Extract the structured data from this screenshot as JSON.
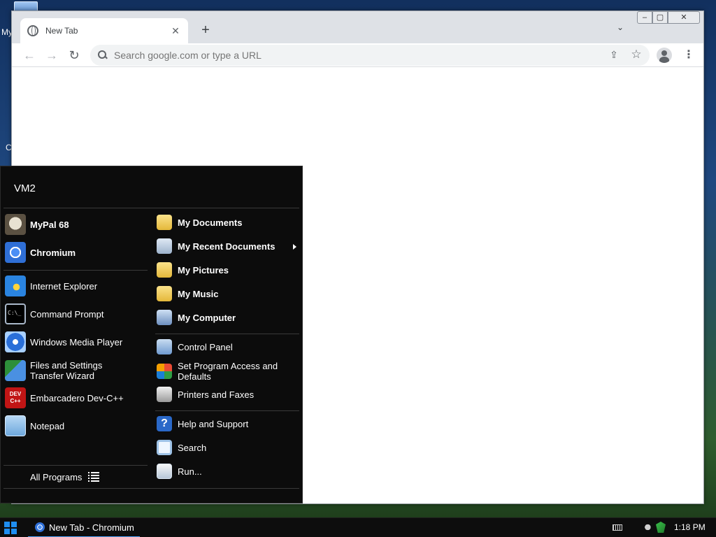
{
  "desktop": {
    "label_1": "My",
    "label_2": "C"
  },
  "browser": {
    "tab_title": "New Tab",
    "tab_close": "✕",
    "new_tab": "+",
    "tab_search": "⌄",
    "window_controls": {
      "minimize": "‒",
      "maximize": "▢",
      "close": "✕"
    },
    "back": "←",
    "forward": "→",
    "reload": "↻",
    "omnibox_placeholder": "Search google.com or type a URL",
    "share": "⇪",
    "bookmark": "☆",
    "menu": "⋮"
  },
  "start_menu": {
    "user": "VM2",
    "pinned": [
      {
        "label": "MyPal 68",
        "icon": "mypal-icon"
      },
      {
        "label": "Chromium",
        "icon": "chromium-icon"
      }
    ],
    "recent": [
      {
        "label": "Internet Explorer",
        "icon": "internet-explorer-icon"
      },
      {
        "label": "Command Prompt",
        "icon": "command-prompt-icon",
        "icon_text": "C:\\_"
      },
      {
        "label": "Windows Media Player",
        "icon": "media-player-icon"
      },
      {
        "label": "Files and Settings Transfer Wizard",
        "icon": "transfer-wizard-icon"
      },
      {
        "label": "Embarcadero Dev-C++",
        "icon": "devcpp-icon",
        "icon_text": "DEV C++"
      },
      {
        "label": "Notepad",
        "icon": "notepad-icon"
      }
    ],
    "all_programs": "All Programs",
    "places": [
      {
        "label": "My Documents",
        "icon": "documents-folder-icon"
      },
      {
        "label": "My Recent Documents",
        "icon": "recent-documents-icon"
      },
      {
        "label": "My Pictures",
        "icon": "pictures-folder-icon"
      },
      {
        "label": "My Music",
        "icon": "music-folder-icon"
      },
      {
        "label": "My Computer",
        "icon": "computer-icon"
      }
    ],
    "settings": [
      {
        "label": "Control Panel",
        "icon": "control-panel-icon"
      },
      {
        "label": "Set Program Access and Defaults",
        "icon": "program-defaults-icon"
      },
      {
        "label": "Printers and Faxes",
        "icon": "printer-icon"
      }
    ],
    "tools": [
      {
        "label": "Help and Support",
        "icon": "help-icon",
        "icon_text": "?"
      },
      {
        "label": "Search",
        "icon": "search-icon"
      },
      {
        "label": "Run...",
        "icon": "run-icon"
      }
    ]
  },
  "taskbar": {
    "task_label": "New Tab - Chromium",
    "clock": "1:18 PM"
  }
}
